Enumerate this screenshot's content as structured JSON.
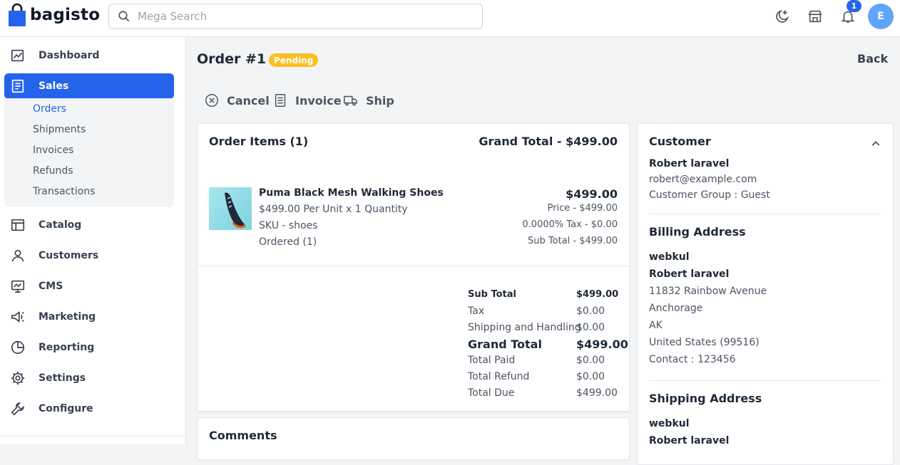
{
  "header": {
    "logo_text": "bagisto",
    "search_placeholder": "Mega Search",
    "notification_count": "1",
    "avatar_initial": "E"
  },
  "sidebar": {
    "items": [
      {
        "label": "Dashboard",
        "icon": "dashboard-icon"
      },
      {
        "label": "Sales",
        "icon": "sales-icon",
        "active": true
      },
      {
        "label": "Catalog",
        "icon": "catalog-icon"
      },
      {
        "label": "Customers",
        "icon": "customers-icon"
      },
      {
        "label": "CMS",
        "icon": "cms-icon"
      },
      {
        "label": "Marketing",
        "icon": "marketing-icon"
      },
      {
        "label": "Reporting",
        "icon": "reporting-icon"
      },
      {
        "label": "Settings",
        "icon": "settings-icon"
      },
      {
        "label": "Configure",
        "icon": "configure-icon"
      }
    ],
    "sales_sub": [
      "Orders",
      "Shipments",
      "Invoices",
      "Refunds",
      "Transactions"
    ]
  },
  "page": {
    "title": "Order #1",
    "status": "Pending",
    "back": "Back",
    "actions": {
      "cancel": "Cancel",
      "invoice": "Invoice",
      "ship": "Ship"
    }
  },
  "order_items": {
    "heading": "Order Items (1)",
    "grand_total_label": "Grand Total - $499.00",
    "product": {
      "name": "Puma Black Mesh Walking Shoes",
      "unit_qty": "$499.00 Per Unit x 1 Quantity",
      "sku": "SKU - shoes",
      "ordered": "Ordered (1)",
      "total": "$499.00",
      "price": "Price - $499.00",
      "tax": "0.0000% Tax - $0.00",
      "sub_total": "Sub Total - $499.00"
    },
    "summary": [
      {
        "label": "Sub Total",
        "value": "$499.00"
      },
      {
        "label": "Tax",
        "value": "$0.00"
      },
      {
        "label": "Shipping and Handling",
        "value": "$0.00"
      },
      {
        "label": "Grand Total",
        "value": "$499.00"
      },
      {
        "label": "Total Paid",
        "value": "$0.00"
      },
      {
        "label": "Total Refund",
        "value": "$0.00"
      },
      {
        "label": "Total Due",
        "value": "$499.00"
      }
    ]
  },
  "comments": {
    "heading": "Comments"
  },
  "customer": {
    "heading": "Customer",
    "name": "Robert laravel",
    "email": "robert@example.com",
    "group": "Customer Group : Guest",
    "billing": {
      "heading": "Billing Address",
      "company": "webkul",
      "name": "Robert laravel",
      "street": "11832 Rainbow Avenue",
      "city": "Anchorage",
      "state": "AK",
      "country": "United States (99516)",
      "contact": "Contact : 123456"
    },
    "shipping": {
      "heading": "Shipping Address",
      "company": "webkul",
      "name": "Robert laravel"
    }
  },
  "colors": {
    "accent": "#2563eb",
    "status_pending": "#fbbf24"
  }
}
